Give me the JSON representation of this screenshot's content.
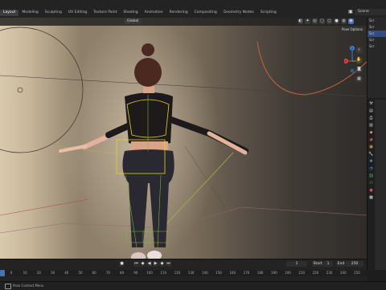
{
  "workspace_tabs": [
    "Layout",
    "Modeling",
    "Sculpting",
    "UV Editing",
    "Texture Paint",
    "Shading",
    "Animation",
    "Rendering",
    "Compositing",
    "Geometry Nodes",
    "Scripting"
  ],
  "scene": "Scene",
  "viewport": {
    "orientation": "Global",
    "pose_options": "Pose Options"
  },
  "gizmo_axes": [
    "Y",
    "X",
    "Z"
  ],
  "outliner_rows": [
    "Scr",
    "Scr",
    "Scr",
    "Scr",
    "Scr"
  ],
  "timeline": {
    "current_frame": "1",
    "start_label": "Start",
    "start_value": "1",
    "end_label": "End",
    "end_value": "250",
    "ticks": [
      "0",
      "10",
      "20",
      "30",
      "40",
      "50",
      "60",
      "70",
      "80",
      "90",
      "100",
      "110",
      "120",
      "130",
      "140",
      "150",
      "160",
      "170",
      "180",
      "190",
      "200",
      "210",
      "220",
      "230",
      "240",
      "250"
    ]
  },
  "status": {
    "text": "Pose Context Menu"
  },
  "colors": {
    "accent": "#4772b3",
    "bone_outline": "#e3d12b",
    "axis_x": "#e04444",
    "axis_y": "#7ab33c",
    "axis_z": "#3a7ed8"
  }
}
